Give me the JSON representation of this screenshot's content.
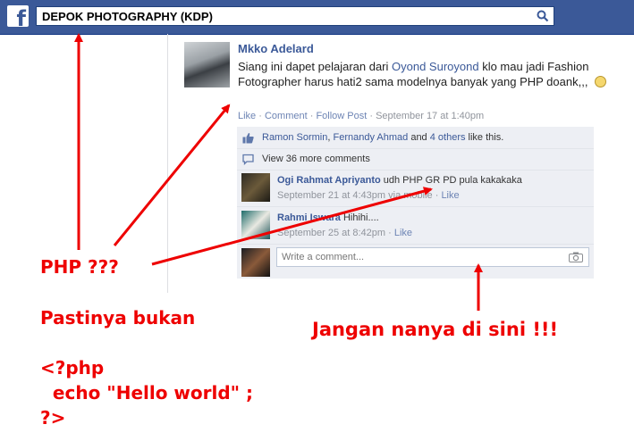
{
  "header": {
    "logo_letter": "f",
    "search_value": "DEPOK PHOTOGRAPHY (KDP)"
  },
  "post": {
    "author": "Mkko Adelard",
    "text_before": "Siang ini dapet pelajaran dari ",
    "mention": "Oyond Suroyond",
    "text_after": " klo mau jadi Fashion Fotographer harus hati2 sama modelnya banyak yang PHP doank,,, ",
    "actions": {
      "like": "Like",
      "sep1": " · ",
      "comment": "Comment",
      "sep2": " · ",
      "follow": "Follow Post",
      "sep3": " · ",
      "time": "September 17 at 1:40pm"
    }
  },
  "likes": {
    "person1": "Ramon Sormin",
    "comma": ", ",
    "person2": "Fernandy Ahmad",
    "and": " and ",
    "others": "4 others",
    "suffix": " like this."
  },
  "more_comments": "View 36 more comments",
  "comments": [
    {
      "author": "Ogi Rahmat Apriyanto",
      "text": " udh PHP GR PD pula kakakaka",
      "time": "September 21 at 4:43pm via mobile",
      "sep": " · ",
      "like": "Like"
    },
    {
      "author": "Rahmi Iswara",
      "text": " Hihihi....",
      "time": "September 25 at 8:42pm",
      "sep": " · ",
      "like": "Like"
    }
  ],
  "comment_input": {
    "placeholder": "Write a comment..."
  },
  "annotations": {
    "php": "PHP ???",
    "pastinya": "Pastinya bukan",
    "code": "<?php\n  echo \"Hello world\" ;\n?>",
    "jangan": "Jangan nanya di sini !!!"
  },
  "colors": {
    "facebook_blue": "#3b5998",
    "annotation_red": "#ee0000"
  }
}
